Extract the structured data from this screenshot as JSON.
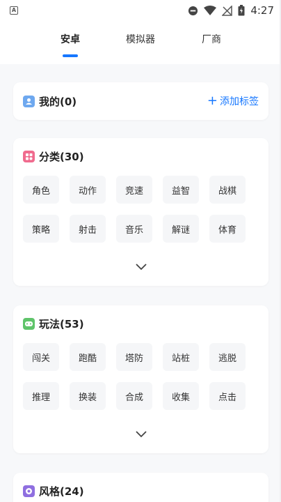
{
  "status_bar": {
    "app_icon_letter": "A",
    "icons": [
      "dnd-icon",
      "wifi-icon",
      "no-signal-icon",
      "battery-icon"
    ],
    "time": "4:27"
  },
  "tabs": [
    {
      "label": "安卓",
      "active": true
    },
    {
      "label": "模拟器",
      "active": false
    },
    {
      "label": "厂商",
      "active": false
    }
  ],
  "accent_color": "#1677ff",
  "mine": {
    "title": "我的(0)",
    "icon_color": "#6ea8ef",
    "add_label": "添加标签"
  },
  "category": {
    "title": "分类(30)",
    "icon_color": "#f06b8e",
    "chips": [
      "角色",
      "动作",
      "竞速",
      "益智",
      "战棋",
      "策略",
      "射击",
      "音乐",
      "解谜",
      "体育"
    ]
  },
  "gameplay": {
    "title": "玩法(53)",
    "icon_color": "#5fc46a",
    "chips": [
      "闯关",
      "跑酷",
      "塔防",
      "站桩",
      "逃脱",
      "推理",
      "换装",
      "合成",
      "收集",
      "点击"
    ]
  },
  "style": {
    "title": "风格(24)",
    "icon_color": "#8f6fe0"
  }
}
